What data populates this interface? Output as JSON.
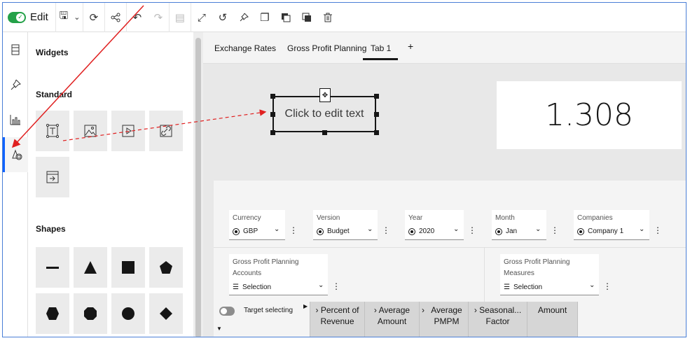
{
  "toolbar": {
    "edit_label": "Edit",
    "icons": [
      "save-icon",
      "chevron-down-icon",
      "sync-icon",
      "share-icon",
      "undo-icon",
      "redo-icon",
      "copy-doc-icon",
      "fullscreen-icon",
      "refresh-icon",
      "pin-icon",
      "duplicate-icon",
      "copy-icon",
      "paste-icon",
      "trash-icon"
    ]
  },
  "rail": {
    "icons": [
      "pages-icon",
      "pin-icon",
      "chart-icon",
      "widgets-icon"
    ]
  },
  "panel": {
    "title": "Widgets",
    "standard_title": "Standard",
    "standard_items": [
      "text-widget-icon",
      "image-widget-icon",
      "media-widget-icon",
      "web-page-widget-icon",
      "navigation-widget-icon"
    ],
    "shapes_title": "Shapes",
    "shape_items": [
      "line-shape",
      "triangle-shape",
      "square-shape",
      "pentagon-shape",
      "hexagon-shape",
      "octagon-shape",
      "circle-shape",
      "diamond-shape"
    ]
  },
  "tabs": {
    "items": [
      "Exchange Rates",
      "Gross Profit Planning",
      "Tab 1"
    ],
    "add_label": "+"
  },
  "text_widget": {
    "placeholder": "Click to edit text"
  },
  "kpi": {
    "value": "1.308"
  },
  "filters": {
    "currency": {
      "label": "Currency",
      "value": "GBP"
    },
    "version": {
      "label": "Version",
      "value": "Budget"
    },
    "year": {
      "label": "Year",
      "value": "2020"
    },
    "month": {
      "label": "Month",
      "value": "Jan"
    },
    "companies": {
      "label": "Companies",
      "value": "Company 1"
    },
    "accounts": {
      "label_line1": "Gross Profit Planning",
      "label_line2": "Accounts",
      "value": "Selection"
    },
    "measures": {
      "label_line1": "Gross Profit Planning",
      "label_line2": "Measures",
      "value": "Selection"
    }
  },
  "grid": {
    "target_selecting": "Target selecting",
    "columns": [
      {
        "line1": "› Percent of",
        "line2": "Revenue"
      },
      {
        "line1": "› Average",
        "line2": "Amount"
      },
      {
        "line1": "Average",
        "line2": "PMPM"
      },
      {
        "line1": "› Seasonal...",
        "line2": "Factor"
      },
      {
        "line1": "Amount",
        "line2": ""
      }
    ]
  },
  "colors": {
    "accent": "#0f62fe",
    "toggle_on": "#24a148",
    "annotation": "#e02020"
  }
}
